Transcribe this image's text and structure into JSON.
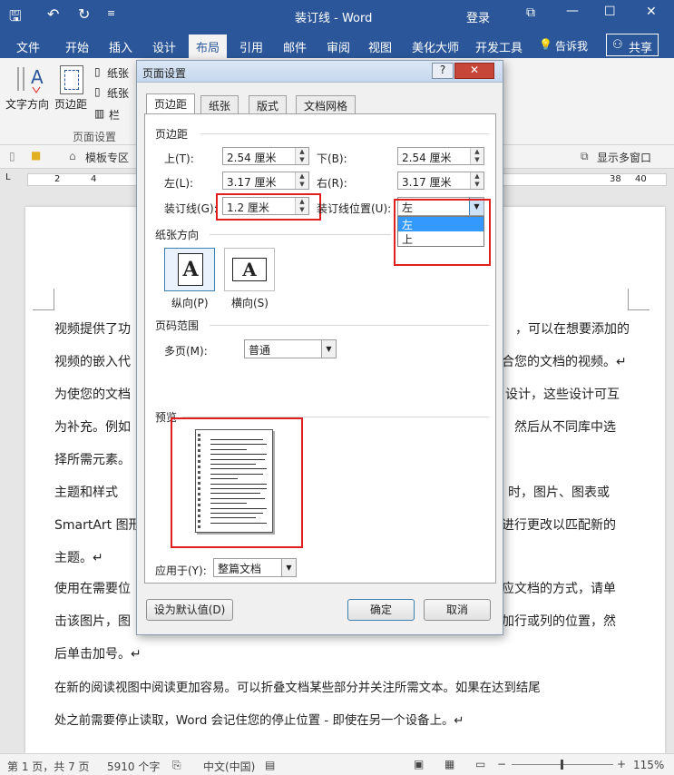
{
  "titlebar": {
    "doc_title": "装订线 - Word",
    "login": "登录"
  },
  "tabs": [
    "文件",
    "开始",
    "插入",
    "设计",
    "布局",
    "引用",
    "邮件",
    "审阅",
    "视图",
    "美化大师",
    "开发工具",
    "告诉我",
    "共享"
  ],
  "ribbon": {
    "text_direction": "文字方向",
    "margins": "页边距",
    "size_item": "纸张",
    "orient_item": "纸张",
    "columns_item": "栏",
    "group_label": "页面设置"
  },
  "navbar": {
    "template_zone": "模板专区",
    "multi_window": "显示多窗口"
  },
  "ruler": {
    "left_nums": [
      "2",
      "4"
    ],
    "right_nums": [
      "38",
      "40"
    ]
  },
  "document": {
    "lines": [
      "视频提供了功",
      "，可以在想要添加的",
      "视频的嵌入代",
      "合您的文档的视频。↵",
      "为使您的文档",
      "设计，这些设计可互",
      "为补充。例如",
      "然后从不同库中选",
      "择所需元素。",
      "主题和样式",
      "时，图片、图表或",
      "SmartArt 图形",
      "进行更改以匹配新的",
      "主题。↵",
      "使用在需要位",
      "应文档的方式，请单",
      "击该图片，图",
      "加行或列的位置，然",
      "后单击加号。↵",
      "在新的阅读视图中阅读更加容易。可以折叠文档某些部分并关注所需文本。如果在达到结尾",
      "处之前需要停止读取，Word 会记住您的停止位置 - 即使在另一个设备上。↵"
    ]
  },
  "statusbar": {
    "page": "第 1 页，共 7 页",
    "words": "5910 个字",
    "lang": "中文(中国)",
    "zoom": "115%"
  },
  "dialog": {
    "title": "页面设置",
    "help": "?",
    "close": "✕",
    "tabs": [
      "页边距",
      "纸张",
      "版式",
      "文档网格"
    ],
    "margins_group": "页边距",
    "top_label": "上(T):",
    "top_value": "2.54 厘米",
    "bottom_label": "下(B):",
    "bottom_value": "2.54 厘米",
    "left_label": "左(L):",
    "left_value": "3.17 厘米",
    "right_label": "右(R):",
    "right_value": "3.17 厘米",
    "gutter_label": "装订线(G):",
    "gutter_value": "1.2 厘米",
    "gutter_pos_label": "装订线位置(U):",
    "gutter_pos_value": "左",
    "gutter_pos_options": [
      "左",
      "上"
    ],
    "orientation_group": "纸张方向",
    "portrait": "纵向(P)",
    "landscape": "横向(S)",
    "orient_icon_letter": "A",
    "pages_group": "页码范围",
    "multi_pages_label": "多页(M):",
    "multi_pages_value": "普通",
    "preview_group": "预览",
    "apply_label": "应用于(Y):",
    "apply_value": "整篇文档",
    "set_default": "设为默认值(D)",
    "ok": "确定",
    "cancel": "取消"
  },
  "colors": {
    "accent": "#2b579a",
    "highlight": "#e0201e",
    "selection": "#3399ff"
  }
}
